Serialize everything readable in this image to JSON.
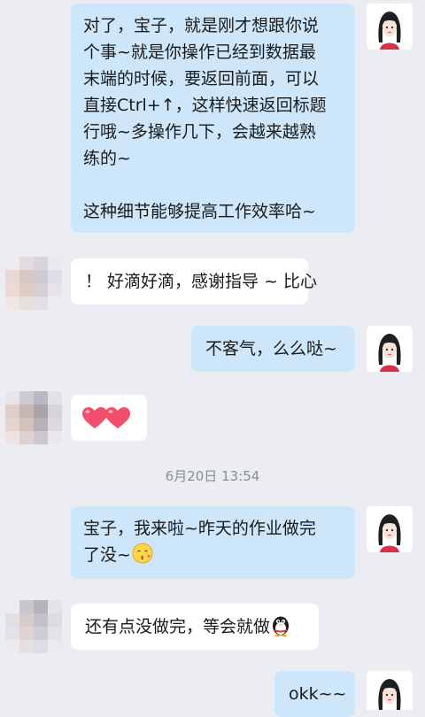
{
  "messages": [
    {
      "sender": "me",
      "lines": [
        "对了，宝子，就是刚才想跟你说",
        "个事~就是你操作已经到数据最",
        "末端的时候，要返回前面，可以",
        "直接Ctrl+↑，这样快速返回标题",
        "行哦~多操作几下，会越来越熟",
        "练的~",
        "",
        "这种细节能够提高工作效率哈~"
      ]
    },
    {
      "sender": "friend",
      "text": "！ 好滴好滴，感谢指导 ~ 比心"
    },
    {
      "sender": "me",
      "text": "不客气，么么哒~"
    },
    {
      "sender": "friend",
      "emoji": "two-hearts"
    },
    {
      "sender": "me",
      "lines": [
        "宝子，我来啦~昨天的作业做完",
        "了没~"
      ],
      "emoji": "kiss-face"
    },
    {
      "sender": "friend",
      "text": "还有点没做完，等会就做",
      "emoji": "qq-penguin"
    },
    {
      "sender": "me",
      "text": "okk~~"
    }
  ],
  "timestamp": "6月20日  13:54",
  "colors": {
    "my_bubble": "#cde6fa",
    "friend_bubble": "#ffffff",
    "background": "#ebedf2"
  }
}
